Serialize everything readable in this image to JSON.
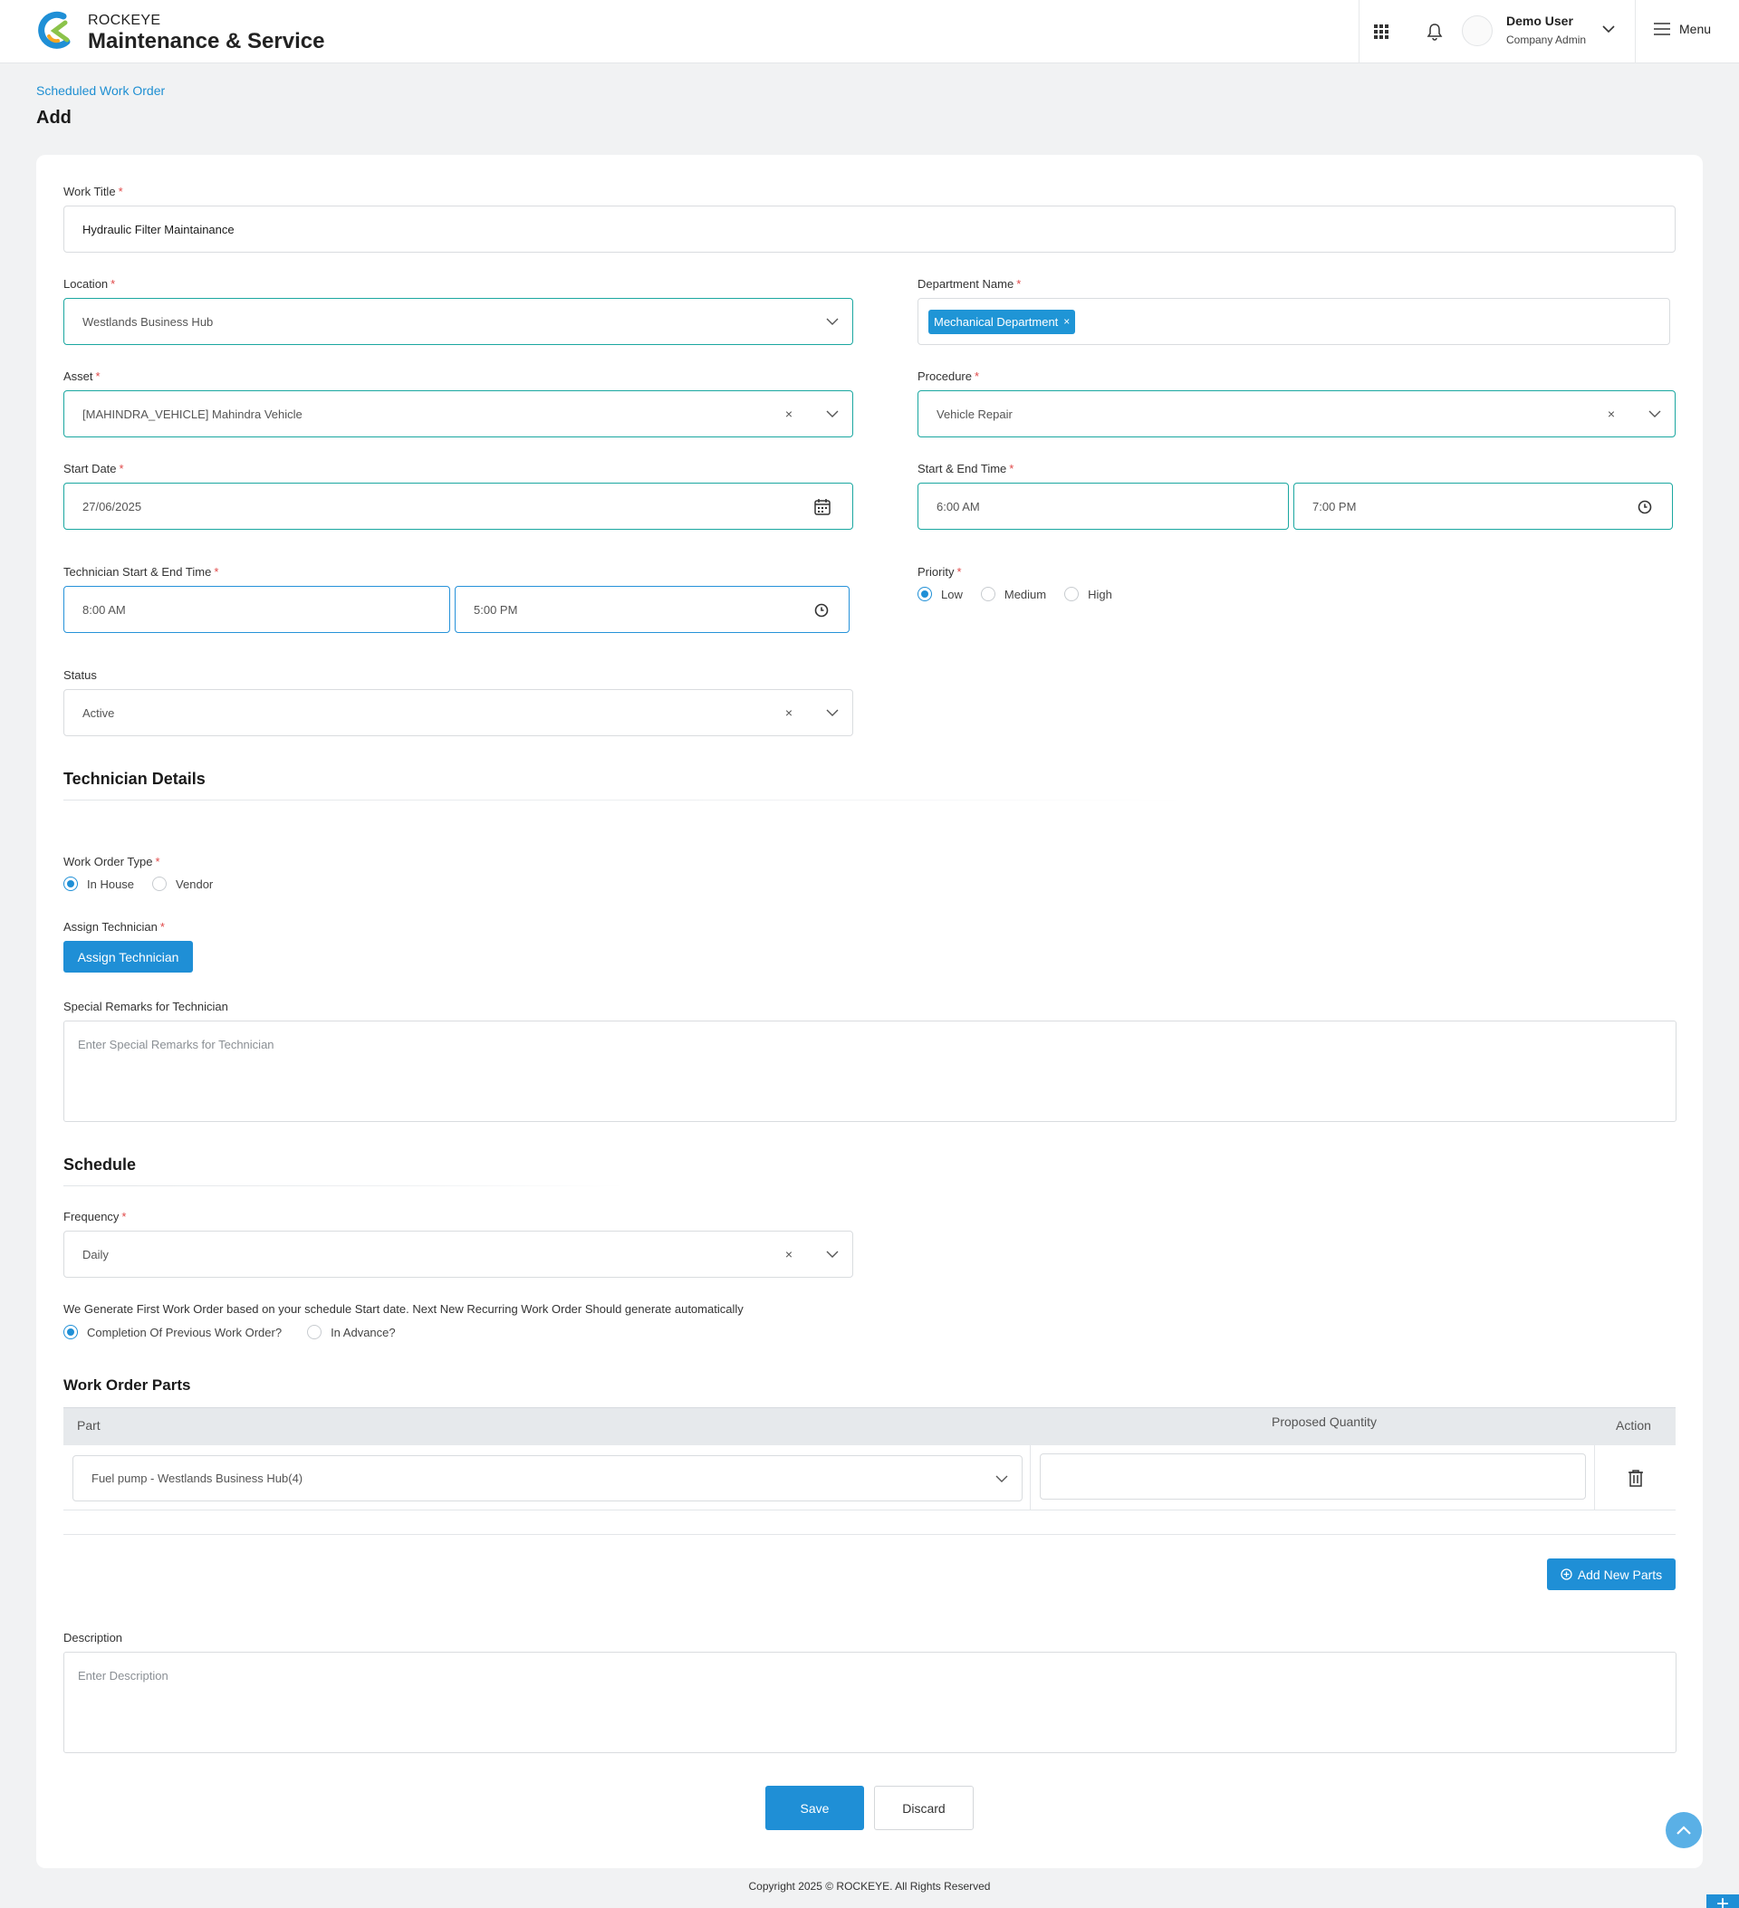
{
  "header": {
    "brand_small": "ROCKEYE",
    "brand_big": "Maintenance & Service",
    "user_name": "Demo User",
    "user_role": "Company Admin",
    "menu_label": "Menu"
  },
  "page": {
    "breadcrumb": "Scheduled Work Order",
    "title": "Add"
  },
  "form": {
    "work_title": {
      "label": "Work Title",
      "value": "Hydraulic Filter Maintainance"
    },
    "location": {
      "label": "Location",
      "value": "Westlands Business Hub"
    },
    "department": {
      "label": "Department Name",
      "tag": "Mechanical Department",
      "tag_remove": "×"
    },
    "asset": {
      "label": "Asset",
      "value": "[MAHINDRA_VEHICLE] Mahindra Vehicle"
    },
    "procedure": {
      "label": "Procedure",
      "value": "Vehicle Repair"
    },
    "start_date": {
      "label": "Start Date",
      "value": "27/06/2025"
    },
    "start_end_time": {
      "label": "Start & End Time",
      "start": "6:00 AM",
      "end": "7:00 PM"
    },
    "technician_time": {
      "label": "Technician Start & End Time",
      "start": "8:00 AM",
      "end": "5:00 PM"
    },
    "priority": {
      "label": "Priority",
      "options": [
        "Low",
        "Medium",
        "High"
      ],
      "selected": "Low"
    },
    "status": {
      "label": "Status",
      "value": "Active"
    },
    "clear_symbol": "×"
  },
  "technician_details": {
    "title": "Technician Details",
    "work_order_type": {
      "label": "Work Order Type",
      "options": [
        "In House",
        "Vendor"
      ],
      "selected": "In House"
    },
    "assign": {
      "label": "Assign Technician",
      "button": "Assign Technician"
    },
    "remarks": {
      "label": "Special Remarks for Technician",
      "placeholder": "Enter Special Remarks for Technician"
    }
  },
  "schedule": {
    "title": "Schedule",
    "frequency": {
      "label": "Frequency",
      "value": "Daily"
    },
    "note": "We Generate First Work Order based on your schedule Start date. Next New Recurring Work Order Should generate automatically",
    "generation": {
      "options": [
        "Completion Of Previous Work Order?",
        "In Advance?"
      ],
      "selected": "Completion Of Previous Work Order?"
    }
  },
  "parts": {
    "title": "Work Order Parts",
    "columns": [
      "Part",
      "Proposed Quantity",
      "Action"
    ],
    "rows": [
      {
        "part": "Fuel pump - Westlands Business Hub(4)",
        "quantity": ""
      }
    ],
    "add_button": "Add New Parts"
  },
  "description": {
    "label": "Description",
    "placeholder": "Enter Description"
  },
  "actions": {
    "save": "Save",
    "discard": "Discard"
  },
  "footer": "Copyright 2025 © ROCKEYE. All Rights Reserved",
  "fab_plus": "+",
  "required_mark": "*",
  "colors": {
    "accent": "#1f8fd6",
    "teal_border": "#1aa7a0",
    "required": "#e04848"
  },
  "icons": [
    "apps-grid-icon",
    "bell-icon",
    "chevron-down-icon",
    "hamburger-icon",
    "calendar-icon",
    "clock-icon",
    "trash-icon",
    "plus-circle-icon",
    "chevron-up-icon"
  ]
}
